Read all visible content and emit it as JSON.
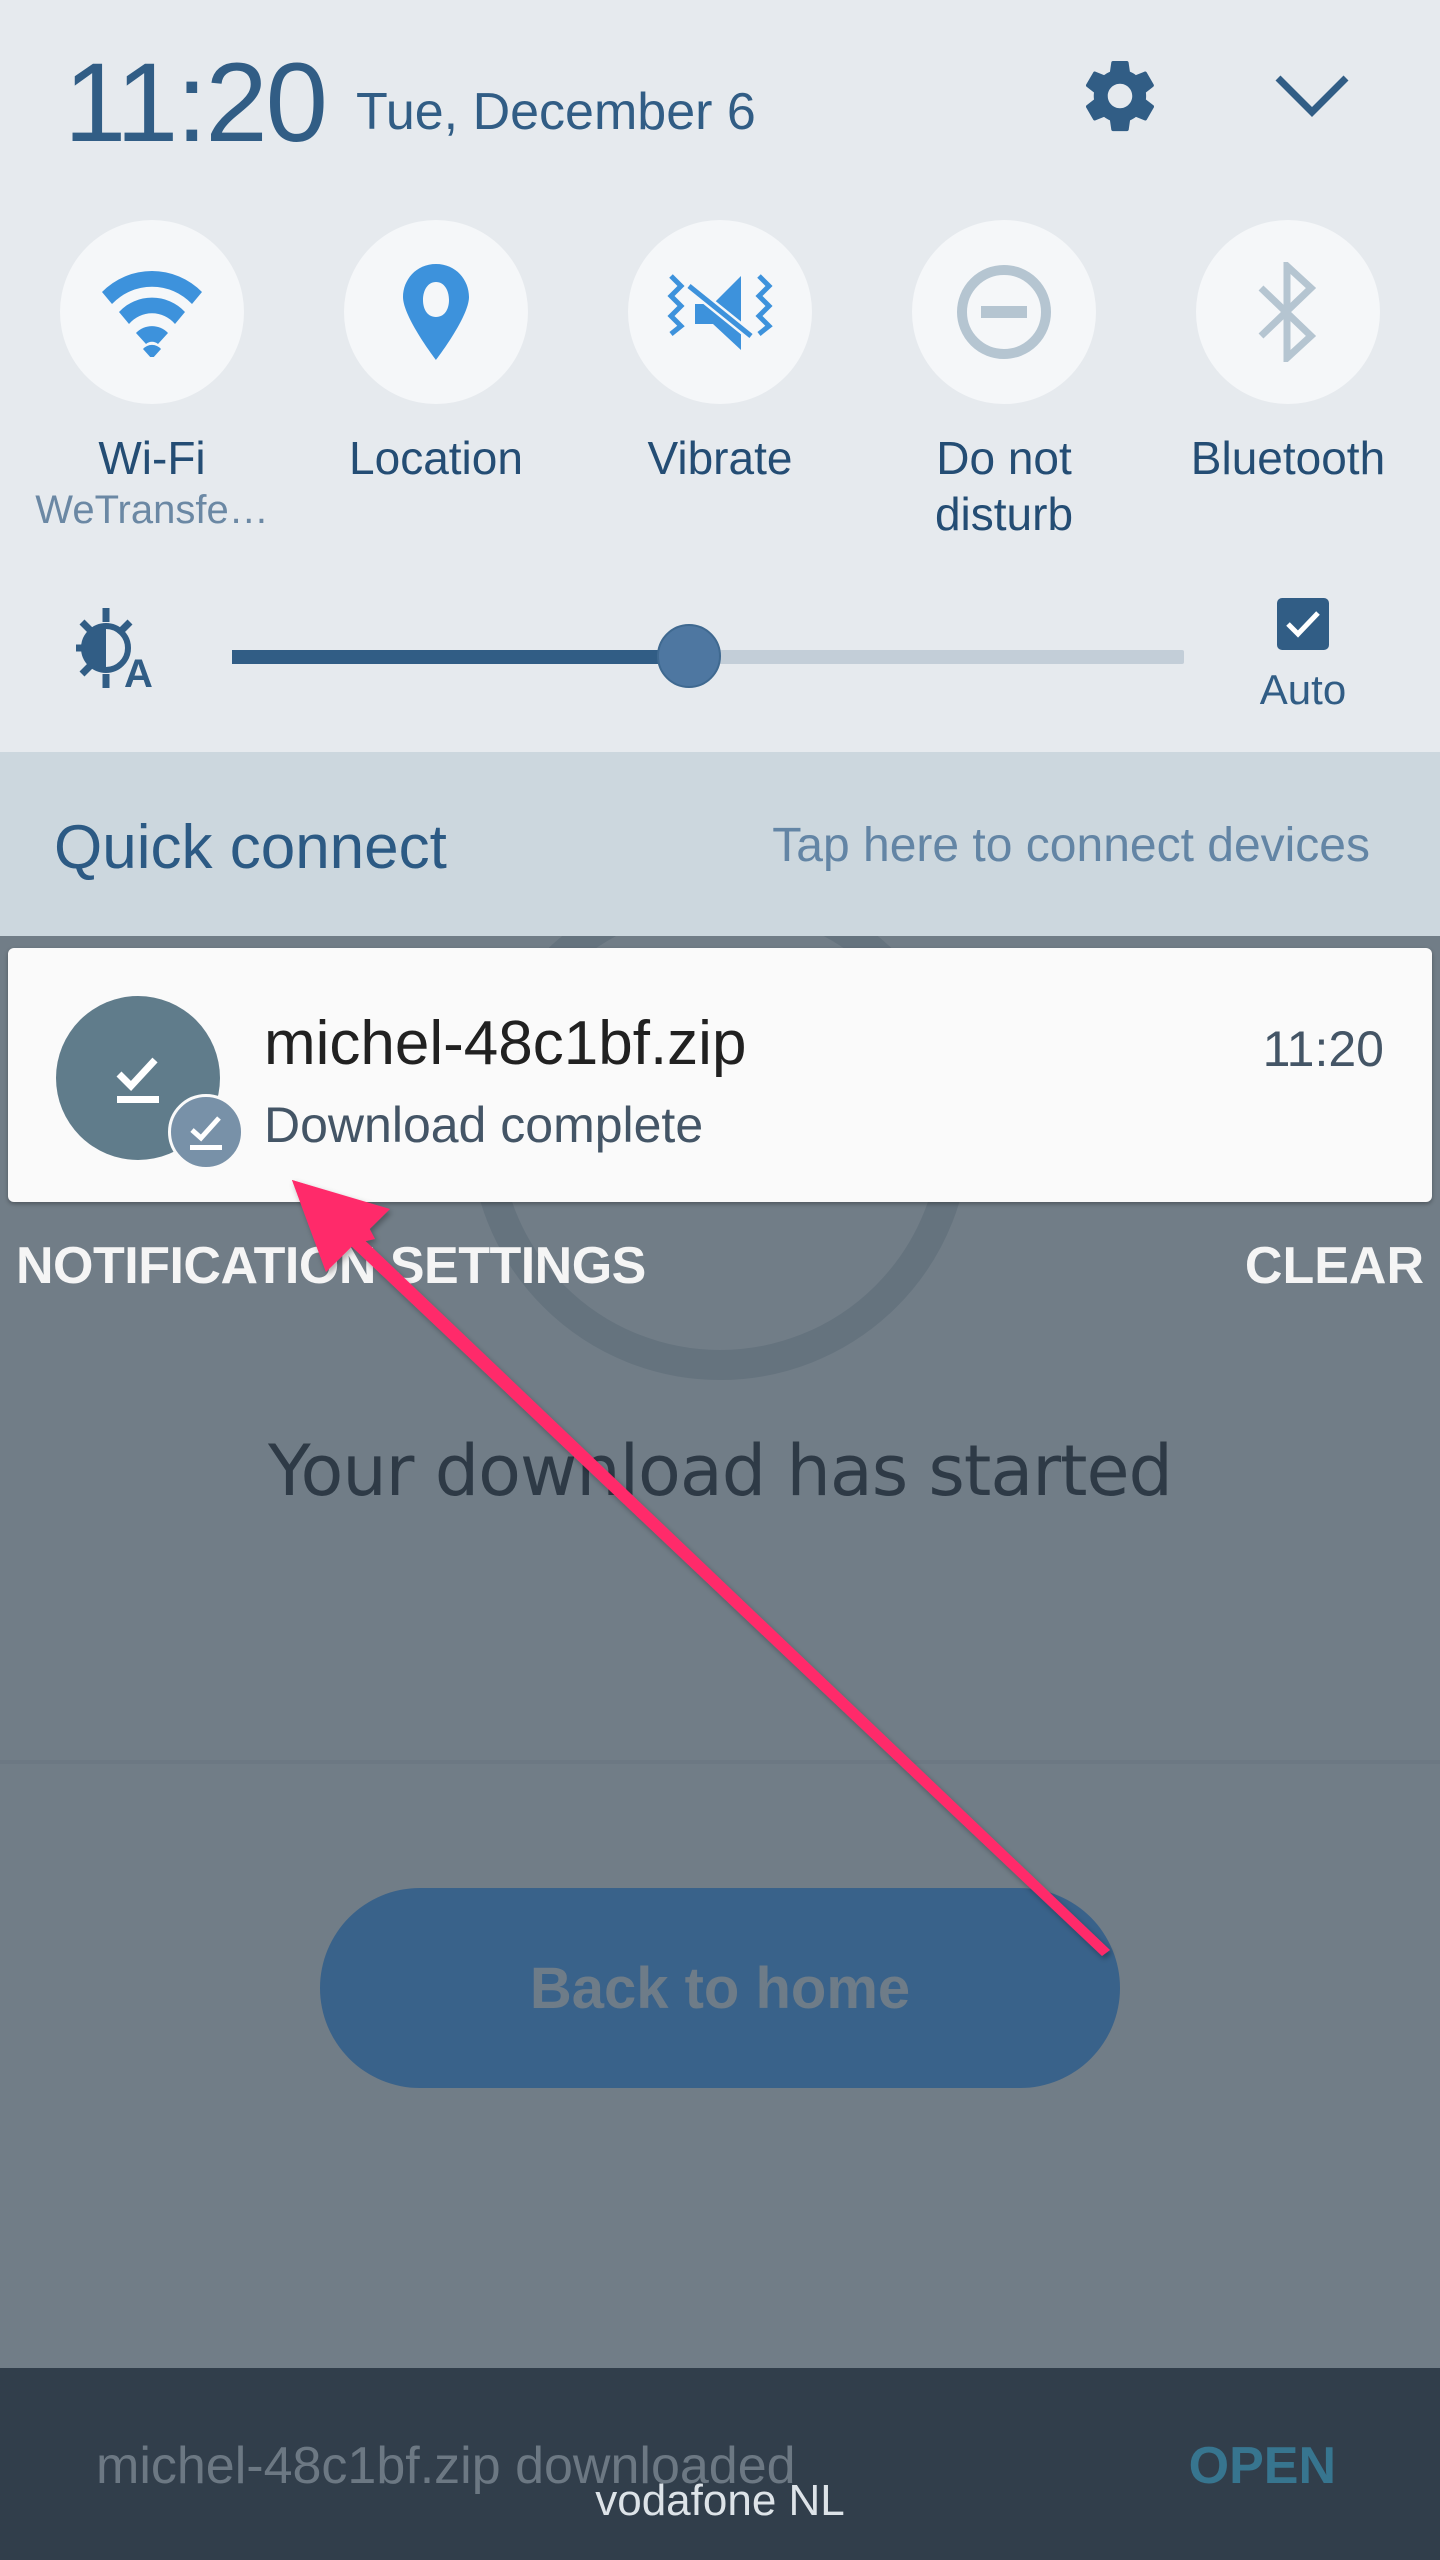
{
  "status": {
    "time": "11:20",
    "date": "Tue, December 6"
  },
  "header_icons": {
    "settings": "gear-icon",
    "collapse": "chevron-down-icon"
  },
  "quick_tiles": [
    {
      "label": "Wi-Fi",
      "sublabel": "WeTransfe…",
      "icon": "wifi-icon",
      "active": true
    },
    {
      "label": "Location",
      "sublabel": "",
      "icon": "location-pin-icon",
      "active": true
    },
    {
      "label": "Vibrate",
      "sublabel": "",
      "icon": "vibrate-icon",
      "active": true
    },
    {
      "label": "Do not disturb",
      "sublabel": "",
      "icon": "do-not-disturb-icon",
      "active": false
    },
    {
      "label": "Bluetooth",
      "sublabel": "",
      "icon": "bluetooth-icon",
      "active": false
    }
  ],
  "brightness": {
    "level_fraction": 0.48,
    "auto_label": "Auto",
    "auto_checked": true
  },
  "quick_connect": {
    "title": "Quick connect",
    "hint": "Tap here to connect devices"
  },
  "notification": {
    "title": "michel-48c1bf.zip",
    "subtitle": "Download complete",
    "time": "11:20",
    "icon": "download-done-icon"
  },
  "notification_actions": {
    "settings_label": "NOTIFICATION SETTINGS",
    "clear_label": "CLEAR"
  },
  "background_app": {
    "heading": "Your download has started",
    "button_label": "Back to home"
  },
  "snackbar": {
    "message": "michel-48c1bf.zip downloaded",
    "action_label": "OPEN"
  },
  "carrier": "vodafone NL",
  "colors": {
    "accent": "#315d85",
    "tile_active": "#3d92dc",
    "tile_inactive": "#b5c5d1",
    "annotation_arrow": "#ff2a6a"
  }
}
